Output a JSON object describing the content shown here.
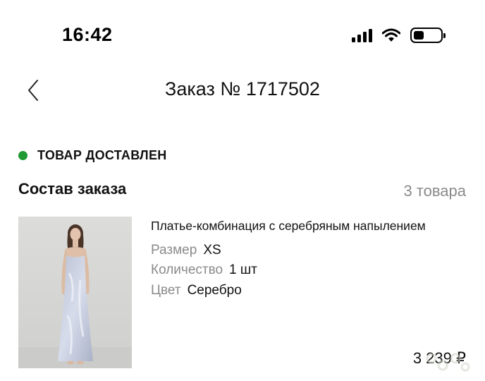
{
  "status_bar": {
    "time": "16:42",
    "icons": [
      "signal-icon",
      "wifi-icon",
      "battery-icon"
    ]
  },
  "header": {
    "back_icon": "chevron-left-icon",
    "title": "Заказ № 1717502"
  },
  "order_status": {
    "text": "ТОВАР ДОСТАВЛЕН",
    "color": "#1f9a32"
  },
  "composition": {
    "title": "Состав заказа",
    "count": "3 товара"
  },
  "item": {
    "name": "Платье-комбинация с серебряным напылением",
    "size_label": "Размер",
    "size_value": "XS",
    "qty_label": "Количество",
    "qty_value": "1 шт",
    "color_label": "Цвет",
    "color_value": "Серебро",
    "price": "3 239 ₽"
  }
}
